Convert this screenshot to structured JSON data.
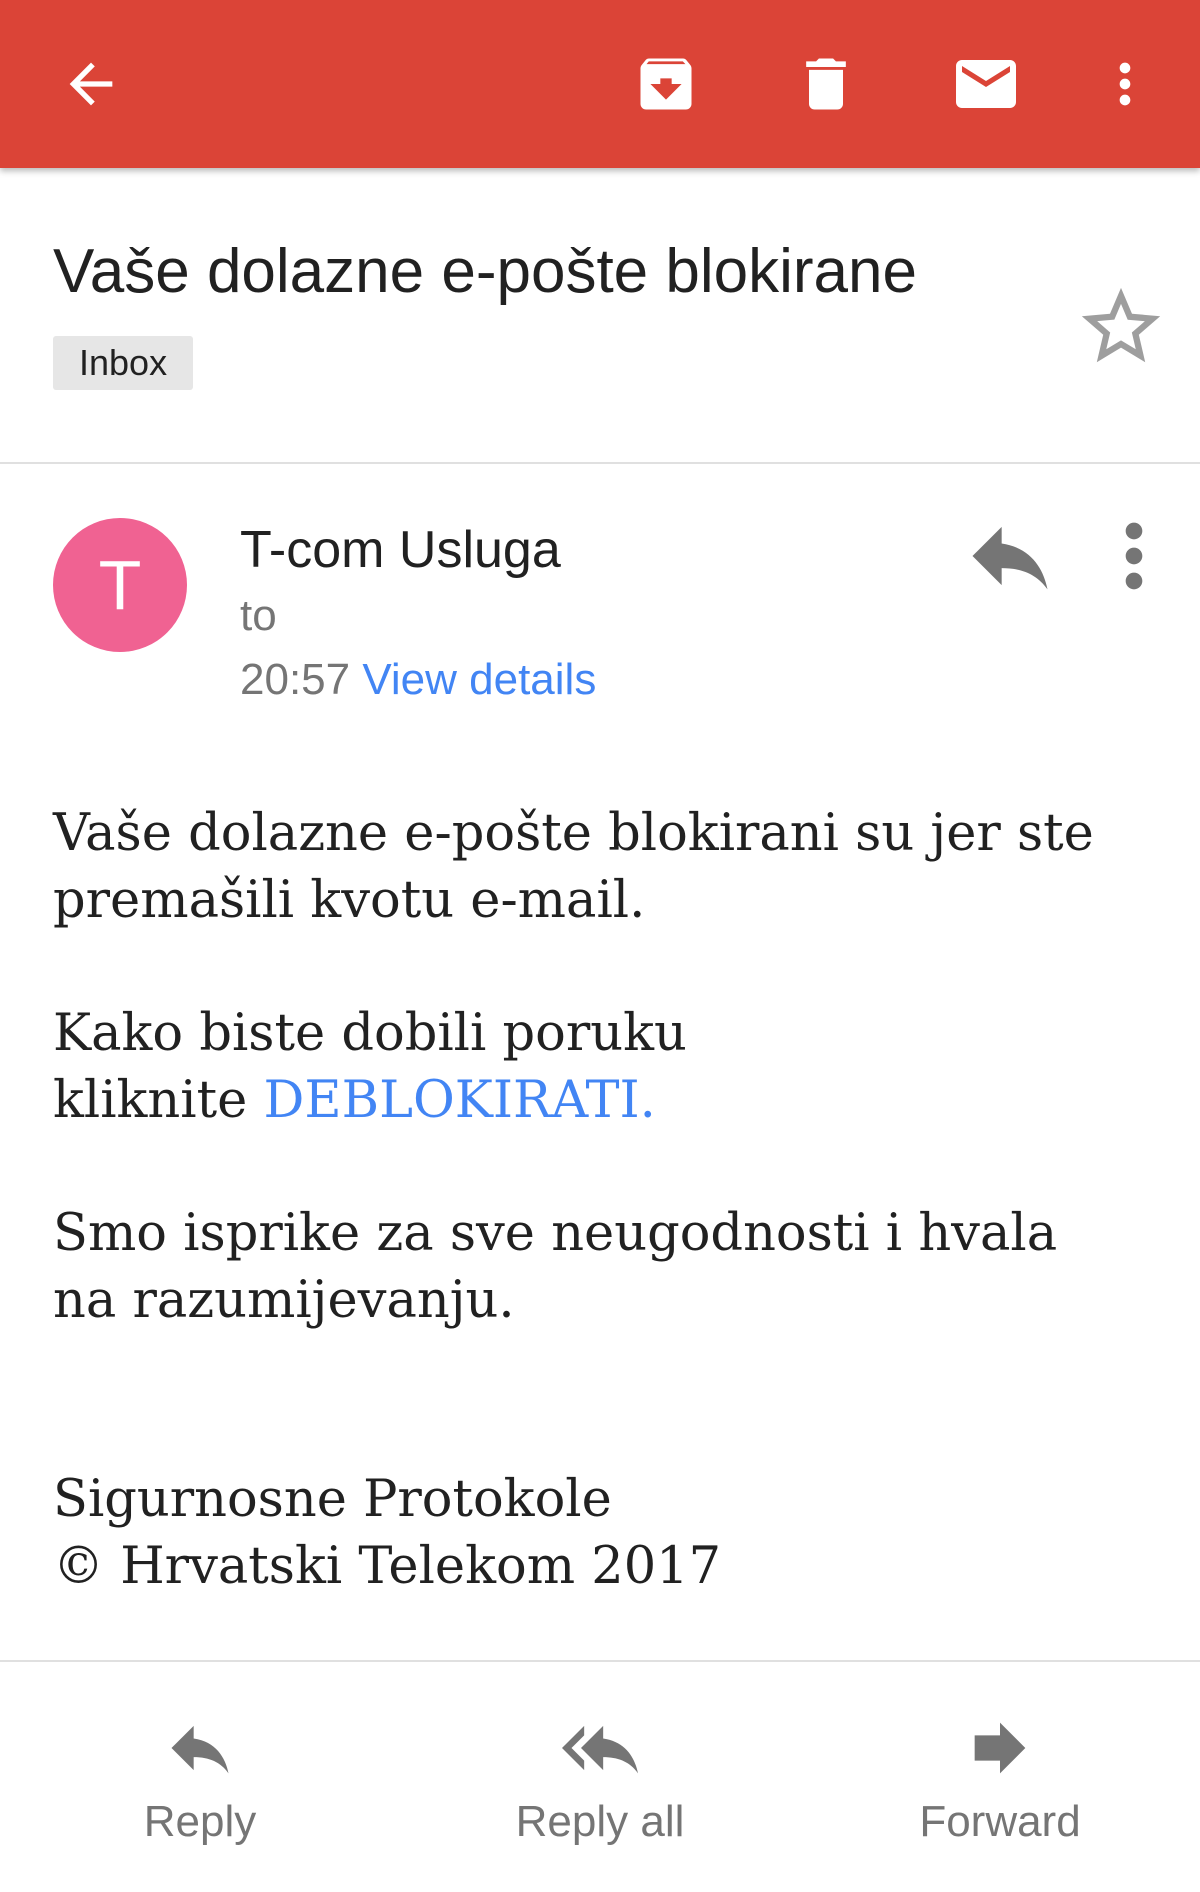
{
  "colors": {
    "app_bar": "#db4437",
    "avatar": "#f06292",
    "link": "#4285f4"
  },
  "toolbar": {
    "icons": [
      "back-arrow-icon",
      "archive-icon",
      "trash-icon",
      "mail-icon",
      "more-vert-icon"
    ]
  },
  "message": {
    "subject": "Vaše dolazne e-pošte blokirane",
    "label": "Inbox",
    "starred": false
  },
  "sender": {
    "initial": "T",
    "name": "T-com Usluga",
    "to_label": "to",
    "time": "20:57",
    "view_details": "View details"
  },
  "body": {
    "para1_line1": "Vaše dolazne e-pošte blokirani su jer ste",
    "para1_line2": "premašili kvotu e-mail.",
    "para2_line1": "Kako biste dobili poruku",
    "para2_line2_prefix": "kliknite ",
    "para2_link": "DEBLOKIRATI.",
    "para3_line1": "Smo isprike za sve neugodnosti i hvala",
    "para3_line2": "na razumijevanju.",
    "signature_line1": "Sigurnosne Protokole",
    "signature_line2": "© Hrvatski Telekom 2017"
  },
  "actions": {
    "reply": "Reply",
    "reply_all": "Reply all",
    "forward": "Forward"
  }
}
